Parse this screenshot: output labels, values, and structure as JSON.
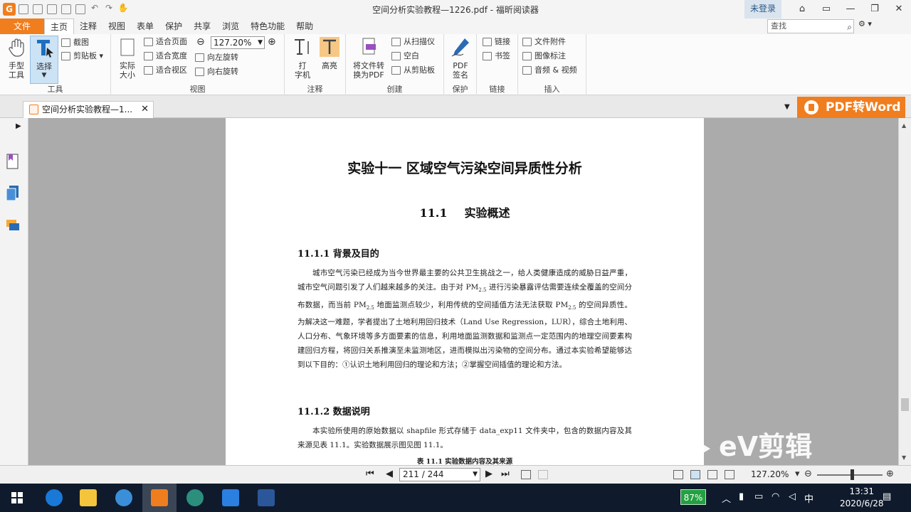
{
  "window": {
    "title": "空间分析实验教程—1226.pdf - 福昕阅读器",
    "login_label": "未登录",
    "search_placeholder": "查找"
  },
  "menu": {
    "file": "文件",
    "tabs": [
      "主页",
      "注释",
      "视图",
      "表单",
      "保护",
      "共享",
      "浏览",
      "特色功能",
      "帮助"
    ]
  },
  "ribbon": {
    "tools": {
      "hand": "手型\n工具",
      "select": "选择",
      "screenshot": "截图",
      "clipboard": "剪贴板",
      "label": "工具"
    },
    "view": {
      "actual_size": "实际\n大小",
      "fit_page": "适合页面",
      "fit_width": "适合宽度",
      "fit_visible": "适合视区",
      "zoom_value": "127.20%",
      "rotate_left": "向左旋转",
      "rotate_right": "向右旋转",
      "label": "视图"
    },
    "comment": {
      "typewriter": "打\n字机",
      "highlight": "高亮",
      "label": "注释"
    },
    "create": {
      "convert": "将文件转\n换为PDF",
      "from_scanner": "从扫描仪",
      "blank": "空白",
      "from_clipboard": "从剪贴板",
      "label": "创建"
    },
    "protect": {
      "pdf_sign": "PDF\n签名",
      "label": "保护"
    },
    "links": {
      "link": "链接",
      "bookmark": "书签",
      "label": "链接"
    },
    "insert": {
      "attachment": "文件附件",
      "image_annot": "图像标注",
      "audio_video": "音频 & 视频",
      "label": "插入"
    }
  },
  "doc_tab": {
    "title": "空间分析实验教程—1..."
  },
  "promo": {
    "pdf_to_word": "PDF转Word"
  },
  "page": {
    "h1": "实验十一 区域空气污染空间异质性分析",
    "h2_num": "11.1",
    "h2_text": "实验概述",
    "h3_1": "11.1.1 背景及目的",
    "para1_a": "城市空气污染已经成为当今世界最主要的公共卫生挑战之一，给人类健康造成的威胁日益严重，城市空气问题引发了人们越来越多的关注。由于对 PM",
    "para1_sub1": "2.5",
    "para1_b": " 进行污染暴露评估需要连续全覆盖的空间分布数据，而当前 PM",
    "para1_sub2": "2.5",
    "para1_c": " 地面监测点较少，利用传统的空间插值方法无法获取 PM",
    "para1_sub3": "2.5",
    "para1_d": " 的空间异质性。为解决这一难题，学者提出了土地利用回归技术（Land Use Regression，LUR），综合土地利用、人口分布、气象环境等多方面要素的信息，利用地面监测数据和监测点一定范围内的地理空间要素构建回归方程，将回归关系推演至未监测地区，进而模拟出污染物的空间分布。通过本实验希望能够达到以下目的：①认识土地利用回归的理论和方法；②掌握空间插值的理论和方法。",
    "h3_2": "11.1.2 数据说明",
    "para2": "本实验所使用的原始数据以 shapfile 形式存储于 data_exp11 文件夹中，包含的数据内容及其来源见表 11.1。实验数据展示图见图 11.1。",
    "caption": "表 11.1  实验数据内容及其来源"
  },
  "status": {
    "page_indicator": "211 / 244",
    "zoom": "127.20%"
  },
  "taskbar": {
    "battery": "87%",
    "ime": "中",
    "time": "13:31",
    "date": "2020/6/28"
  },
  "watermark": {
    "ev": "eV剪辑"
  }
}
